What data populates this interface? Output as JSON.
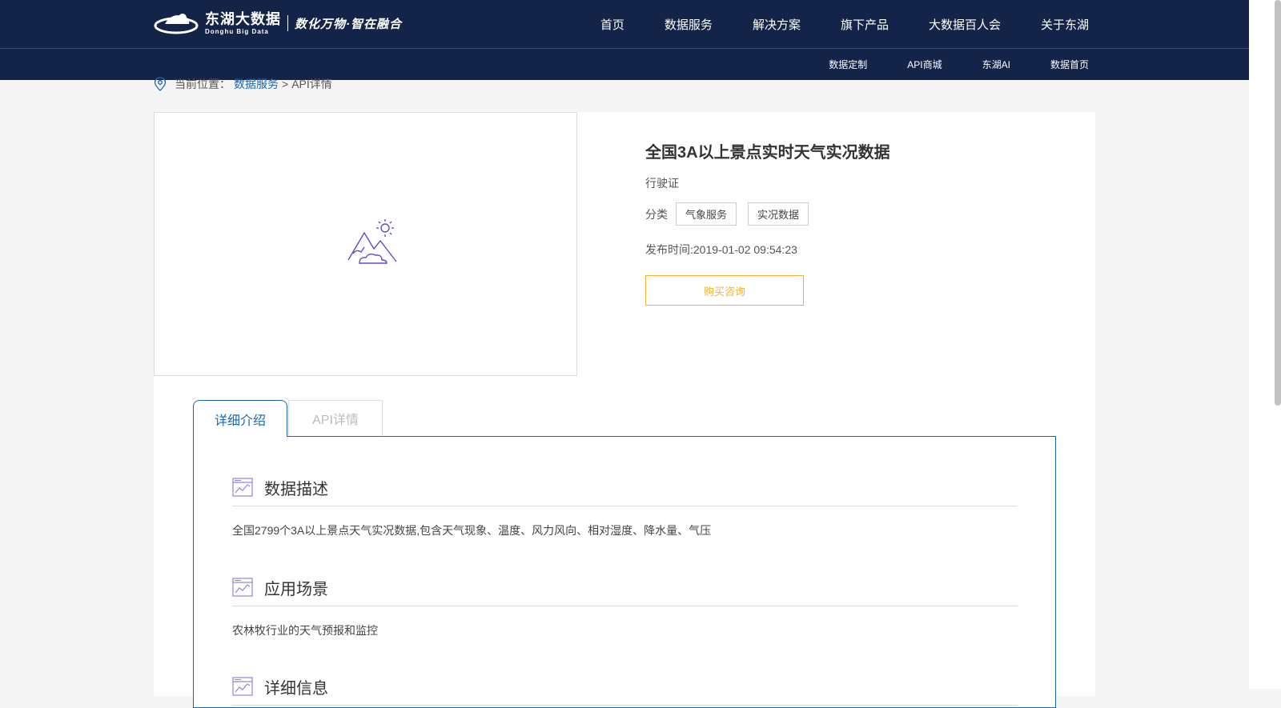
{
  "header": {
    "logo_cn": "东湖大数据",
    "logo_en": "Donghu Big Data",
    "slogan": "数化万物·智在融合",
    "nav": [
      "首页",
      "数据服务",
      "解决方案",
      "旗下产品",
      "大数据百人会",
      "关于东湖"
    ],
    "subnav": [
      "数据定制",
      "API商城",
      "东湖AI",
      "数据首页"
    ]
  },
  "breadcrumb": {
    "prefix": "当前位置：",
    "link": "数据服务",
    "sep": ">",
    "current": "API详情"
  },
  "product": {
    "title": "全国3A以上景点实时天气实况数据",
    "subtitle": "行驶证",
    "category_label": "分类",
    "tags": [
      "气象服务",
      "实况数据"
    ],
    "publish_time": "发布时间:2019-01-02 09:54:23",
    "buy_button": "购买咨询"
  },
  "tabs": [
    "详细介绍",
    "API详情"
  ],
  "sections": [
    {
      "title": "数据描述",
      "body": "全国2799个3A以上景点天气实况数据,包含天气现象、温度、风力风向、相对湿度、降水量、气压"
    },
    {
      "title": "应用场景",
      "body": "农林牧行业的天气预报和监控"
    },
    {
      "title": "详细信息",
      "body": ""
    }
  ],
  "colors": {
    "header_bg": "#142449",
    "link_blue": "#1966b3",
    "accent_orange": "#f5b22d"
  }
}
